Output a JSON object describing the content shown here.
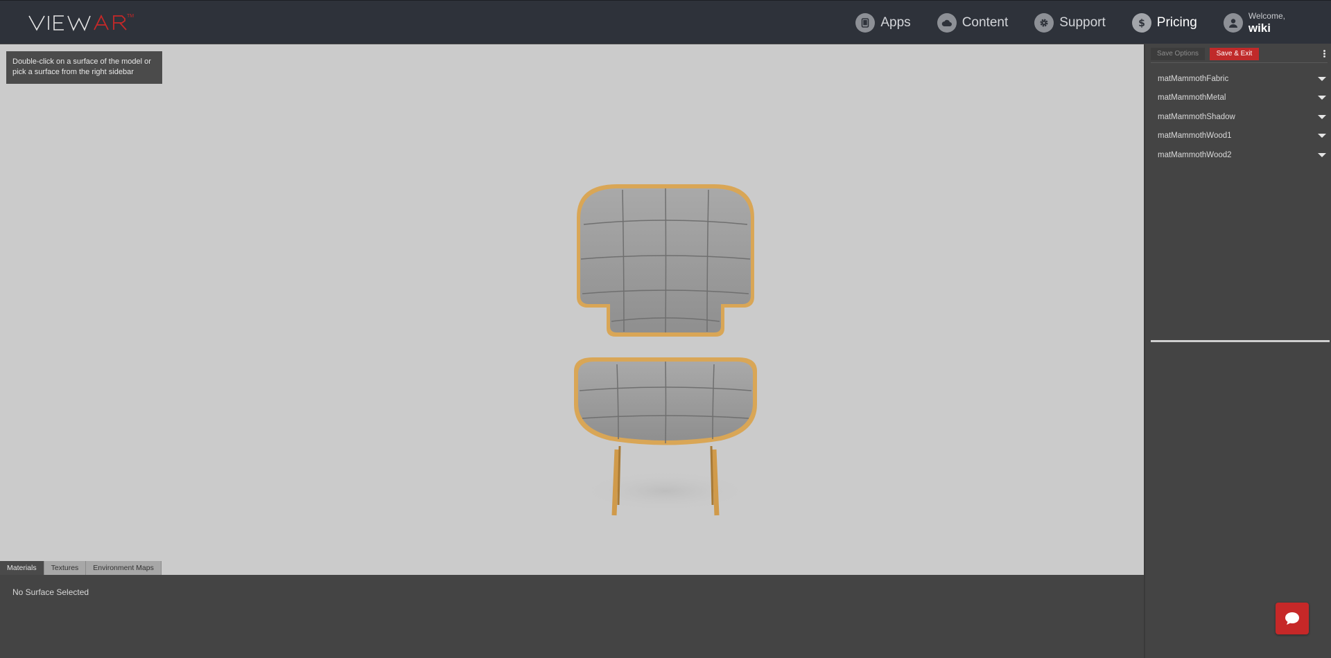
{
  "header": {
    "logo_text": "VIEWAR",
    "logo_tm": "TM",
    "nav": [
      {
        "label": "Apps",
        "icon": "tablet-icon"
      },
      {
        "label": "Content",
        "icon": "cloud-icon"
      },
      {
        "label": "Support",
        "icon": "gear-icon"
      },
      {
        "label": "Pricing",
        "icon": "dollar-icon"
      }
    ],
    "welcome_label": "Welcome,",
    "username": "wiki"
  },
  "viewport": {
    "hint": "Double-click on a surface of the model or pick a surface from the right sidebar",
    "tabs": [
      "Materials",
      "Textures",
      "Environment Maps"
    ],
    "active_tab": "Materials"
  },
  "bottom_panel": {
    "status": "No Surface Selected"
  },
  "sidebar": {
    "save_options_label": "Save Options",
    "save_exit_label": "Save & Exit",
    "materials": [
      "matMammothFabric",
      "matMammothMetal",
      "matMammothShadow",
      "matMammothWood1",
      "matMammothWood2"
    ]
  },
  "colors": {
    "header_bg": "#2e323a",
    "accent_red": "#c02a2a",
    "viewport_bg": "#cbcbcb",
    "panel_bg": "#444444"
  }
}
